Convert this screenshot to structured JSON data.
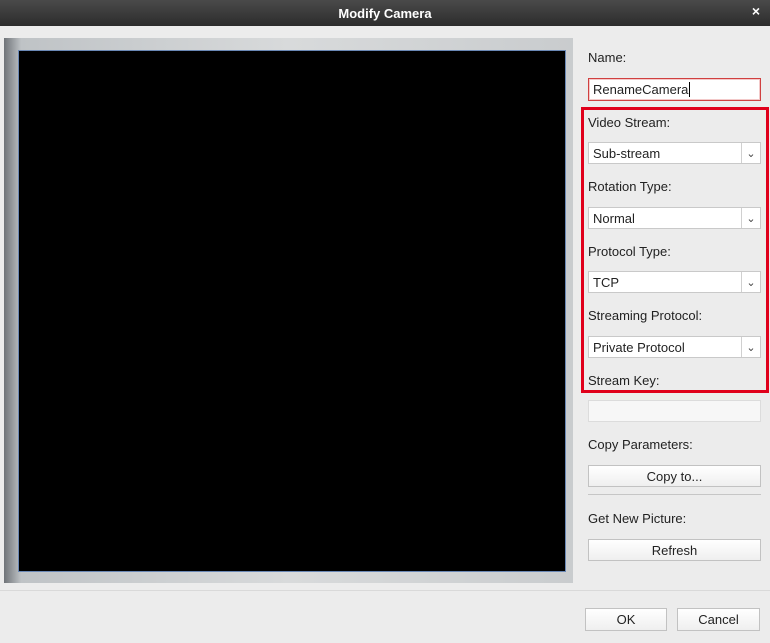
{
  "window": {
    "title": "Modify Camera",
    "close_glyph": "×"
  },
  "form": {
    "name_label": "Name:",
    "name_value": "RenameCamera",
    "video_stream_label": "Video Stream:",
    "video_stream_value": "Sub-stream",
    "rotation_type_label": "Rotation Type:",
    "rotation_type_value": "Normal",
    "protocol_type_label": "Protocol Type:",
    "protocol_type_value": "TCP",
    "streaming_protocol_label": "Streaming Protocol:",
    "streaming_protocol_value": "Private Protocol",
    "stream_key_label": "Stream Key:",
    "stream_key_value": "",
    "copy_parameters_label": "Copy Parameters:",
    "copy_button": "Copy to...",
    "get_new_picture_label": "Get New Picture:",
    "refresh_button": "Refresh"
  },
  "footer": {
    "ok_button": "OK",
    "cancel_button": "Cancel"
  },
  "icons": {
    "dropdown": "chevron-down-icon",
    "close": "close-icon"
  },
  "colors": {
    "highlight_border": "#e0001b",
    "focus_border": "#d04040",
    "title_bar": "#333333"
  }
}
